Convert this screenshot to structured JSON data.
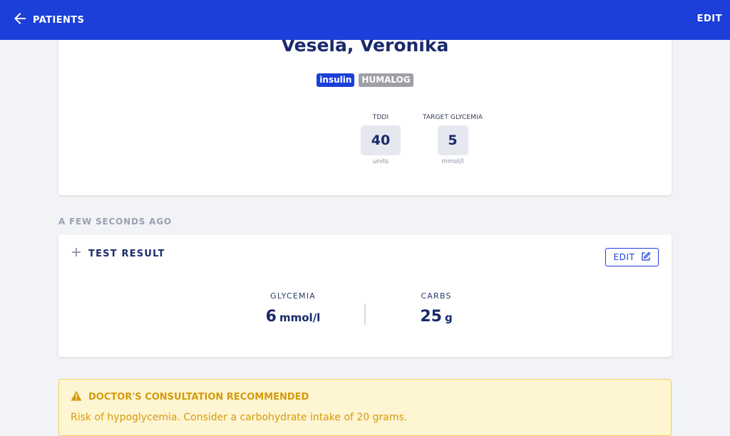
{
  "topbar": {
    "back_label": "PATIENTS",
    "edit_label": "EDIT"
  },
  "patient": {
    "name": "Veselá, Veronika",
    "badges": [
      "insulin",
      "HUMALOG"
    ],
    "stats": [
      {
        "label": "TDDI",
        "value": "40",
        "unit": "units"
      },
      {
        "label": "TARGET GLYCEMIA",
        "value": "5",
        "unit": "mmol/l"
      }
    ]
  },
  "entry": {
    "timestamp": "A FEW SECONDS AGO",
    "title": "TEST RESULT",
    "edit_label": "EDIT",
    "metrics": [
      {
        "label": "GLYCEMIA",
        "value": "6",
        "unit": "mmol/l"
      },
      {
        "label": "CARBS",
        "value": "25",
        "unit": "g"
      }
    ]
  },
  "alert": {
    "title": "DOCTOR'S CONSULTATION RECOMMENDED",
    "text": "Risk of hypoglycemia. Consider a carbohydrate intake of 20 grams."
  },
  "colors": {
    "primary": "#1c3fd9",
    "warning": "#d59a0b",
    "warning_bg": "#fef5d3"
  },
  "icons": [
    "arrow-left-icon",
    "plus-icon",
    "edit-icon",
    "warning-icon"
  ]
}
